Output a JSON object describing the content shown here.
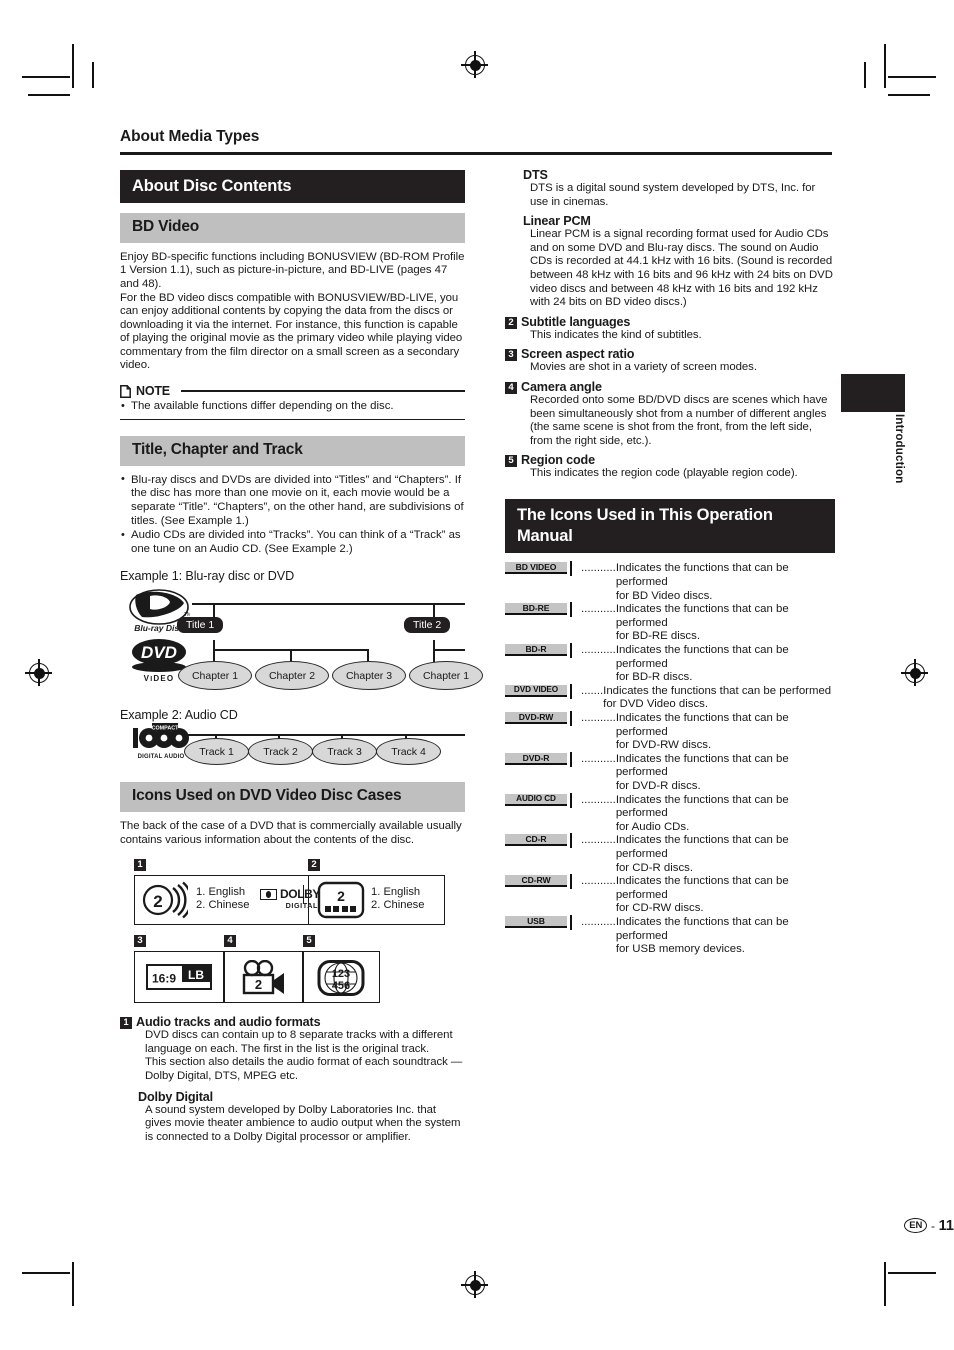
{
  "page": {
    "running_head": "About Media Types",
    "side_tab_label": "Introduction",
    "footer_lang": "EN",
    "footer_dash": "-",
    "footer_page": "11"
  },
  "left": {
    "section_title": "About Disc Contents",
    "bd_video": {
      "heading": "BD Video",
      "paragraph": "Enjoy BD-specific functions including BONUSVIEW (BD-ROM Profile 1 Version 1.1), such as picture-in-picture, and BD-LIVE (pages 47 and 48).",
      "paragraph2": "For the BD video discs compatible with BONUSVIEW/BD-LIVE, you can enjoy additional contents by copying the data from the discs or downloading it via the internet. For instance, this function is capable of playing the original movie as the primary video while playing video commentary from the film director on a small screen as a secondary video."
    },
    "note": {
      "title": "NOTE",
      "items": [
        "The available functions differ depending on the disc."
      ]
    },
    "title_chapter_track": {
      "heading": "Title, Chapter and Track",
      "bullets": [
        "Blu-ray discs and DVDs are divided into “Titles” and “Chapters”. If the disc has more than one movie on it, each movie would be a separate “Title”. “Chapters”, on the other hand, are subdivisions of titles. (See Example 1.)",
        "Audio CDs are divided into “Tracks”. You can think of a “Track” as one tune on an Audio CD. (See Example 2.)"
      ]
    },
    "example1": {
      "caption": "Example 1: Blu-ray disc or DVD",
      "titles": [
        "Title 1",
        "Title 2"
      ],
      "chapters": [
        "Chapter 1",
        "Chapter 2",
        "Chapter 3",
        "Chapter 1"
      ],
      "logo_bd": "Blu-ray Disc",
      "logo_dvd": "DVD VIDEO"
    },
    "example2": {
      "caption": "Example 2: Audio CD",
      "tracks": [
        "Track 1",
        "Track 2",
        "Track 3",
        "Track 4"
      ],
      "logo_cd": "COMPACT disc DIGITAL AUDIO"
    },
    "dvd_case_icons": {
      "heading": "Icons Used on DVD Video Disc Cases",
      "intro": "The back of the case of a DVD that is commercially available usually contains various information about the contents of the disc.",
      "box1": {
        "num": "1",
        "speaker_num": "2",
        "langs": [
          "1. English",
          "2. Chinese"
        ],
        "dolby_word": "DOLBY",
        "dolby_sub": "DIGITAL"
      },
      "box2": {
        "num": "2",
        "sub_num": "2",
        "langs": [
          "1. English",
          "2. Chinese"
        ]
      },
      "box3": {
        "num": "3",
        "ratio": "16:9",
        "lb": "LB"
      },
      "box4": {
        "num": "4",
        "camera_num": "2"
      },
      "box5": {
        "num": "5",
        "digits_top": "123",
        "digits_bottom": "456"
      }
    },
    "definitions": [
      {
        "num": "1",
        "term": "Audio tracks and audio formats",
        "body": "DVD discs can contain up to 8 separate tracks with a different language on each. The first in the list is the original track.",
        "body2": "This section also details the audio format of each soundtrack — Dolby Digital, DTS, MPEG etc."
      }
    ],
    "dolby_digital": {
      "term": "Dolby Digital",
      "body": "A sound system developed by Dolby Laboratories Inc. that gives movie theater ambience to audio output when the system is connected to a Dolby Digital processor or amplifier."
    }
  },
  "right": {
    "dts": {
      "term": "DTS",
      "body": "DTS is a digital sound system developed by DTS, Inc. for use in cinemas."
    },
    "linear_pcm": {
      "term": "Linear PCM",
      "body": "Linear PCM is a signal recording format used for Audio CDs and on some DVD and Blu-ray discs. The sound on Audio CDs is recorded at 44.1 kHz with 16 bits. (Sound is recorded between 48 kHz with 16 bits and 96 kHz with 24 bits on DVD video discs and between 48 kHz with 16 bits and 192 kHz with 24 bits on BD video discs.)"
    },
    "numbered": [
      {
        "num": "2",
        "term": "Subtitle languages",
        "body": "This indicates the kind of subtitles."
      },
      {
        "num": "3",
        "term": "Screen aspect ratio",
        "body": "Movies are shot in a variety of screen modes."
      },
      {
        "num": "4",
        "term": "Camera angle",
        "body": "Recorded onto some BD/DVD discs are scenes which have been simultaneously shot from a number of different angles (the same scene is shot from the front, from the left side, from the right side, etc.)."
      },
      {
        "num": "5",
        "term": "Region code",
        "body": "This indicates the region code (playable region code)."
      }
    ],
    "icons_section": {
      "heading": "The Icons Used in This Operation Manual",
      "rows": [
        {
          "badge": "BD VIDEO",
          "dots": "...........",
          "line1": "Indicates the functions that can be performed",
          "line2": "for BD Video discs."
        },
        {
          "badge": "BD-RE",
          "dots": "...........",
          "line1": "Indicates the functions that can be performed",
          "line2": "for BD-RE discs."
        },
        {
          "badge": "BD-R",
          "dots": "...........",
          "line1": "Indicates the functions that can be performed",
          "line2": "for BD-R discs."
        },
        {
          "badge": "DVD VIDEO",
          "dots": ".......",
          "line1": "Indicates the functions that can be performed",
          "line2": "for DVD Video discs."
        },
        {
          "badge": "DVD-RW",
          "dots": "...........",
          "line1": "Indicates the functions that can be performed",
          "line2": "for DVD-RW discs."
        },
        {
          "badge": "DVD-R",
          "dots": "...........",
          "line1": "Indicates the functions that can be performed",
          "line2": "for DVD-R discs."
        },
        {
          "badge": "AUDIO CD",
          "dots": "...........",
          "line1": "Indicates the functions that can be performed",
          "line2": "for Audio CDs."
        },
        {
          "badge": "CD-R",
          "dots": "...........",
          "line1": "Indicates the functions that can be performed",
          "line2": "for CD-R discs."
        },
        {
          "badge": "CD-RW",
          "dots": "...........",
          "line1": "Indicates the functions that can be performed",
          "line2": "for CD-RW discs."
        },
        {
          "badge": "USB",
          "dots": "...........",
          "line1": "Indicates the functions that can be performed",
          "line2": "for USB memory devices."
        }
      ]
    }
  },
  "colors": {
    "black_bar": "#231f20",
    "gray_bar": "#bfbfbf",
    "badge_gray": "#c4c4c4",
    "node_gray": "#d8d8d8"
  }
}
